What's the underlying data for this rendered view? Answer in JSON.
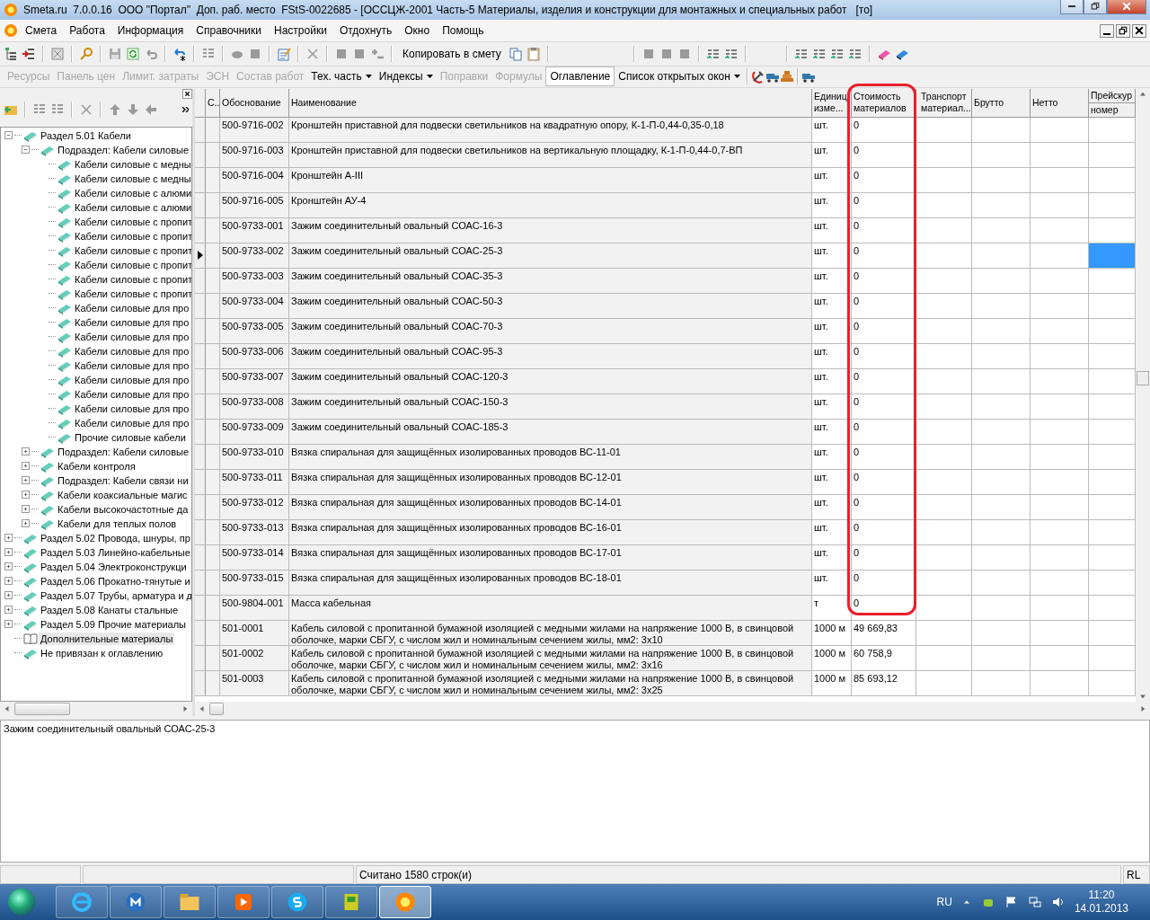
{
  "window": {
    "title": "Smeta.ru  7.0.0.16  ООО \"Портал\"  Доп. раб. место  FStS-0022685 - [ОССЦЖ-2001 Часть-5 Материалы, изделия и конструкции для монтажных и специальных работ   [то]"
  },
  "menu": [
    "Смета",
    "Работа",
    "Информация",
    "Справочники",
    "Настройки",
    "Отдохнуть",
    "Окно",
    "Помощь"
  ],
  "toolbar": {
    "copy_button": "Копировать в смету"
  },
  "view_bar": [
    {
      "label": "Ресурсы",
      "disabled": true,
      "dropdown": false,
      "selected": false
    },
    {
      "label": "Панель цен",
      "disabled": true,
      "dropdown": false,
      "selected": false
    },
    {
      "label": "Лимит. затраты",
      "disabled": true,
      "dropdown": false,
      "selected": false
    },
    {
      "label": "ЭСН",
      "disabled": true,
      "dropdown": false,
      "selected": false
    },
    {
      "label": "Состав работ",
      "disabled": true,
      "dropdown": false,
      "selected": false
    },
    {
      "label": "Тех. часть",
      "disabled": false,
      "dropdown": true,
      "selected": false
    },
    {
      "label": "Индексы",
      "disabled": false,
      "dropdown": true,
      "selected": false
    },
    {
      "label": "Поправки",
      "disabled": true,
      "dropdown": false,
      "selected": false
    },
    {
      "label": "Формулы",
      "disabled": true,
      "dropdown": false,
      "selected": false
    },
    {
      "label": "Оглавление",
      "disabled": false,
      "dropdown": false,
      "selected": true
    },
    {
      "label": "Список открытых окон",
      "disabled": false,
      "dropdown": true,
      "selected": false
    }
  ],
  "tree": [
    {
      "label": "Раздел 5.01 Кабели",
      "kind": "book",
      "expanded": true,
      "selected": false,
      "children": [
        {
          "label": "Подраздел: Кабели силовые",
          "kind": "book",
          "expanded": true,
          "selected": false,
          "children": [
            {
              "label": "Кабели силовые с медны",
              "kind": "book",
              "selected": false
            },
            {
              "label": "Кабели силовые с медны",
              "kind": "book",
              "selected": false
            },
            {
              "label": "Кабели силовые с алюми",
              "kind": "book",
              "selected": false
            },
            {
              "label": "Кабели силовые с алюми",
              "kind": "book",
              "selected": false
            },
            {
              "label": "Кабели силовые с пропит",
              "kind": "book",
              "selected": false
            },
            {
              "label": "Кабели силовые с пропит",
              "kind": "book",
              "selected": false
            },
            {
              "label": "Кабели силовые с пропит",
              "kind": "book",
              "selected": false
            },
            {
              "label": "Кабели силовые с пропит",
              "kind": "book",
              "selected": false
            },
            {
              "label": "Кабели силовые с пропит",
              "kind": "book",
              "selected": false
            },
            {
              "label": "Кабели силовые с пропит",
              "kind": "book",
              "selected": false
            },
            {
              "label": "Кабели силовые для про",
              "kind": "book",
              "selected": false
            },
            {
              "label": "Кабели силовые для про",
              "kind": "book",
              "selected": false
            },
            {
              "label": "Кабели силовые для про",
              "kind": "book",
              "selected": false
            },
            {
              "label": "Кабели силовые для про",
              "kind": "book",
              "selected": false
            },
            {
              "label": "Кабели силовые для про",
              "kind": "book",
              "selected": false
            },
            {
              "label": "Кабели силовые для про",
              "kind": "book",
              "selected": false
            },
            {
              "label": "Кабели силовые для про",
              "kind": "book",
              "selected": false
            },
            {
              "label": "Кабели силовые для про",
              "kind": "book",
              "selected": false
            },
            {
              "label": "Кабели силовые для про",
              "kind": "book",
              "selected": false
            },
            {
              "label": "Прочие силовые кабели",
              "kind": "book",
              "selected": false
            }
          ]
        },
        {
          "label": "Подраздел: Кабели силовые",
          "kind": "book",
          "expanded": false,
          "selected": false
        },
        {
          "label": "Кабели контроля",
          "kind": "book",
          "expanded": false,
          "selected": false
        },
        {
          "label": "Подраздел: Кабели связи ни",
          "kind": "book",
          "expanded": false,
          "selected": false
        },
        {
          "label": "Кабели коаксиальные магис",
          "kind": "book",
          "expanded": false,
          "selected": false
        },
        {
          "label": "Кабели высокочастотные да",
          "kind": "book",
          "expanded": false,
          "selected": false
        },
        {
          "label": "Кабели для теплых полов",
          "kind": "book",
          "expanded": false,
          "selected": false
        }
      ]
    },
    {
      "label": "Раздел 5.02 Провода, шнуры, пр",
      "kind": "book",
      "expanded": false,
      "selected": false
    },
    {
      "label": "Раздел 5.03 Линейно-кабельные",
      "kind": "book",
      "expanded": false,
      "selected": false
    },
    {
      "label": "Раздел 5.04 Электроконструкци",
      "kind": "book",
      "expanded": false,
      "selected": false
    },
    {
      "label": "Раздел 5.06 Прокатно-тянутые и",
      "kind": "book",
      "expanded": false,
      "selected": false
    },
    {
      "label": "Раздел 5.07 Трубы, арматура и д",
      "kind": "book",
      "expanded": false,
      "selected": false
    },
    {
      "label": "Раздел 5.08 Канаты стальные",
      "kind": "book",
      "expanded": false,
      "selected": false
    },
    {
      "label": "Раздел 5.09 Прочие материалы",
      "kind": "book",
      "expanded": false,
      "selected": false
    },
    {
      "label": "Дополнительные материалы",
      "kind": "open-book",
      "selected": true
    },
    {
      "label": "Не привязан к оглавлению",
      "kind": "book",
      "selected": false
    }
  ],
  "table": {
    "columns": [
      {
        "lines": [
          "С.."
        ]
      },
      {
        "lines": [
          "Обоснование"
        ]
      },
      {
        "lines": [
          "Наименование"
        ]
      },
      {
        "lines": [
          "Единиц",
          "изме..."
        ]
      },
      {
        "lines": [
          "Стоимость",
          "материалов"
        ]
      },
      {
        "lines": [
          "Транспорт",
          "материал..."
        ]
      },
      {
        "lines": [
          "Брутто"
        ]
      },
      {
        "lines": [
          "Нетто"
        ]
      },
      {
        "lines": [
          "Прейскур",
          "номер"
        ]
      }
    ],
    "rows": [
      {
        "code": "500-9716-002",
        "name": "Кронштейн приставной для подвески светильников на квадратную опору, К-1-П-0,44-0,35-0,18",
        "unit": "шт.",
        "cost": "0",
        "selected": false
      },
      {
        "code": "500-9716-003",
        "name": "Кронштейн приставной для подвески светильников на вертикальную площадку, К-1-П-0,44-0,7-ВП",
        "unit": "шт.",
        "cost": "0",
        "selected": false
      },
      {
        "code": "500-9716-004",
        "name": "Кронштейн А-III",
        "unit": "шт.",
        "cost": "0",
        "selected": false
      },
      {
        "code": "500-9716-005",
        "name": "Кронштейн АУ-4",
        "unit": "шт.",
        "cost": "0",
        "selected": false
      },
      {
        "code": "500-9733-001",
        "name": "Зажим соединительный овальный СОАС-16-3",
        "unit": "шт.",
        "cost": "0",
        "selected": false
      },
      {
        "code": "500-9733-002",
        "name": "Зажим соединительный овальный СОАС-25-3",
        "unit": "шт.",
        "cost": "0",
        "selected": true
      },
      {
        "code": "500-9733-003",
        "name": "Зажим соединительный овальный СОАС-35-3",
        "unit": "шт.",
        "cost": "0",
        "selected": false
      },
      {
        "code": "500-9733-004",
        "name": "Зажим соединительный овальный СОАС-50-3",
        "unit": "шт.",
        "cost": "0",
        "selected": false
      },
      {
        "code": "500-9733-005",
        "name": "Зажим соединительный овальный СОАС-70-3",
        "unit": "шт.",
        "cost": "0",
        "selected": false
      },
      {
        "code": "500-9733-006",
        "name": "Зажим соединительный овальный СОАС-95-3",
        "unit": "шт.",
        "cost": "0",
        "selected": false
      },
      {
        "code": "500-9733-007",
        "name": "Зажим соединительный овальный СОАС-120-3",
        "unit": "шт.",
        "cost": "0",
        "selected": false
      },
      {
        "code": "500-9733-008",
        "name": "Зажим соединительный овальный СОАС-150-3",
        "unit": "шт.",
        "cost": "0",
        "selected": false
      },
      {
        "code": "500-9733-009",
        "name": "Зажим соединительный овальный СОАС-185-3",
        "unit": "шт.",
        "cost": "0",
        "selected": false
      },
      {
        "code": "500-9733-010",
        "name": "Вязка спиральная для защищённых изолированных проводов ВС-11-01",
        "unit": "шт.",
        "cost": "0",
        "selected": false
      },
      {
        "code": "500-9733-011",
        "name": "Вязка спиральная для защищённых изолированных проводов ВС-12-01",
        "unit": "шт.",
        "cost": "0",
        "selected": false
      },
      {
        "code": "500-9733-012",
        "name": "Вязка спиральная для защищённых изолированных проводов ВС-14-01",
        "unit": "шт.",
        "cost": "0",
        "selected": false
      },
      {
        "code": "500-9733-013",
        "name": "Вязка спиральная для защищённых изолированных проводов ВС-16-01",
        "unit": "шт.",
        "cost": "0",
        "selected": false
      },
      {
        "code": "500-9733-014",
        "name": "Вязка спиральная для защищённых изолированных проводов ВС-17-01",
        "unit": "шт.",
        "cost": "0",
        "selected": false
      },
      {
        "code": "500-9733-015",
        "name": "Вязка спиральная для защищённых изолированных проводов ВС-18-01",
        "unit": "шт.",
        "cost": "0",
        "selected": false
      },
      {
        "code": "500-9804-001",
        "name": "Масса кабельная",
        "unit": "т",
        "cost": "0",
        "selected": false
      },
      {
        "code": "501-0001",
        "name": "Кабель силовой с пропитанной бумажной изоляцией с медными жилами на напряжение 1000 В, в свинцовой оболочке, марки СБГУ, с числом жил и номинальным сечением жилы, мм2: 3х10",
        "unit": "1000 м",
        "cost": "49 669,83",
        "selected": false
      },
      {
        "code": "501-0002",
        "name": "Кабель силовой с пропитанной бумажной изоляцией с медными жилами на напряжение 1000 В, в свинцовой оболочке, марки СБГУ, с числом жил и номинальным сечением жилы, мм2: 3х16",
        "unit": "1000 м",
        "cost": "60 758,9",
        "selected": false
      },
      {
        "code": "501-0003",
        "name": "Кабель силовой с пропитанной бумажной изоляцией с медными жилами на напряжение 1000 В, в свинцовой оболочке, марки СБГУ, с числом жил и номинальным сечением жилы, мм2: 3х25",
        "unit": "1000 м",
        "cost": "85 693,12",
        "selected": false
      }
    ]
  },
  "details": {
    "text": "Зажим соединительный овальный СОАС-25-3"
  },
  "status_bar": {
    "message": "Считано 1580 строк(и)",
    "indicator": "RL"
  },
  "taskbar": {
    "buttons": [
      {
        "selected": false
      },
      {
        "selected": false
      },
      {
        "selected": false
      },
      {
        "selected": false
      },
      {
        "selected": false
      },
      {
        "selected": false
      },
      {
        "selected": true
      }
    ],
    "language": "RU",
    "time": "11:20",
    "date": "14.01.2013"
  }
}
